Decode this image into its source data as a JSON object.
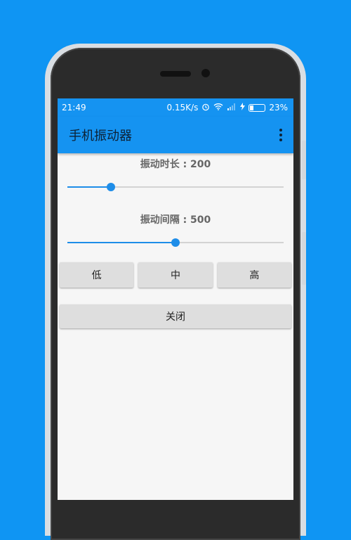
{
  "status_bar": {
    "time": "21:49",
    "speed": "0.15K/s",
    "battery": "23%"
  },
  "app_bar": {
    "title": "手机振动器"
  },
  "duration": {
    "label": "振动时长 : 200",
    "value_fraction": 0.2
  },
  "interval": {
    "label": "振动间隔 : 500",
    "value_fraction": 0.5
  },
  "buttons": {
    "low": "低",
    "mid": "中",
    "high": "高",
    "close": "关闭"
  },
  "colors": {
    "background": "#0f95f3",
    "app_bar": "#1593f1",
    "accent": "#1e8de8"
  },
  "icons": [
    "alarm-icon",
    "wifi-icon",
    "signal-icon",
    "charging-icon",
    "battery-icon",
    "more-vert-icon"
  ]
}
